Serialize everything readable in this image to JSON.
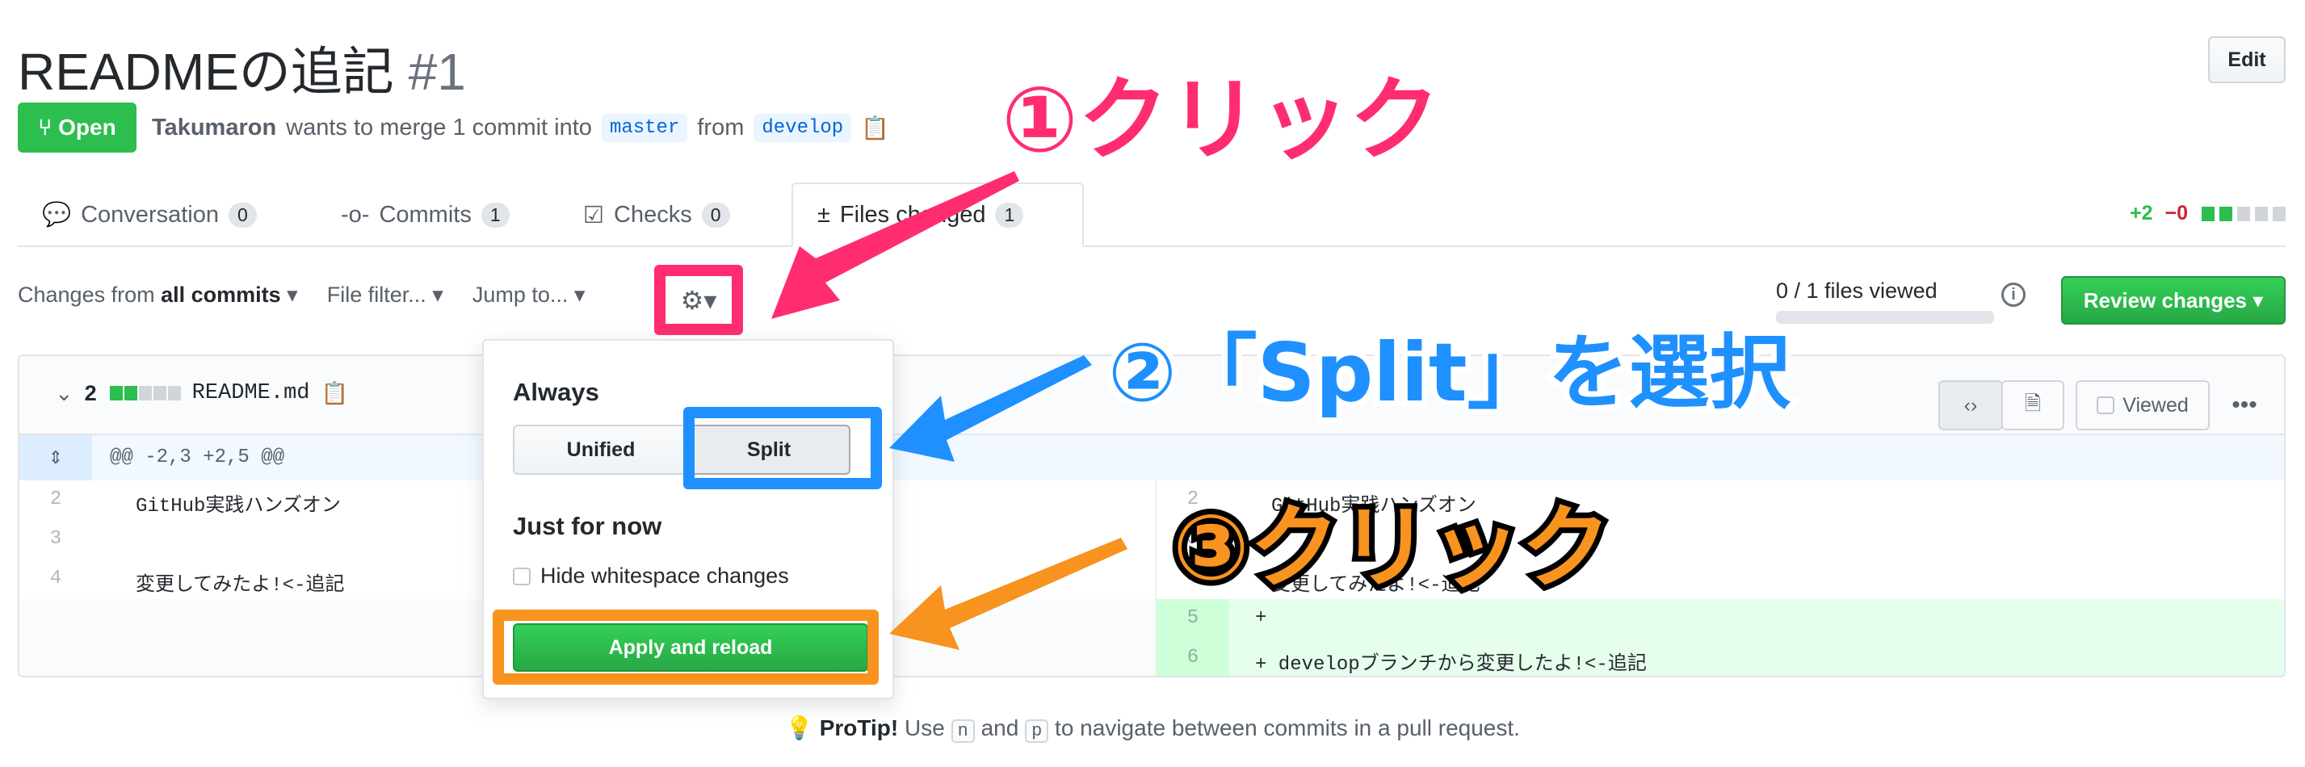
{
  "header": {
    "title": "READMEの追記",
    "number": "#1",
    "edit_label": "Edit",
    "status": "Open",
    "author": "Takumaron",
    "merge_text": "wants to merge 1 commit into",
    "base": "master",
    "from": "from",
    "head": "develop"
  },
  "tabs": [
    {
      "label": "Conversation",
      "count": "0",
      "icon": "comment-discussion-icon"
    },
    {
      "label": "Commits",
      "count": "1",
      "icon": "git-commit-icon"
    },
    {
      "label": "Checks",
      "count": "0",
      "icon": "checklist-icon"
    },
    {
      "label": "Files changed",
      "count": "1",
      "icon": "file-diff-icon",
      "selected": true
    }
  ],
  "diffstat": {
    "added": "+2",
    "removed": "−0",
    "colors": {
      "added": "#2cbe4e",
      "removed": "#cb2431",
      "neutral": "#d1d5da"
    }
  },
  "toolbar": {
    "changes_prefix": "Changes from",
    "changes_value": "all commits",
    "file_filter": "File filter...",
    "jump_to": "Jump to...",
    "files_viewed": "0 / 1 files viewed",
    "review_label": "Review changes"
  },
  "file": {
    "changes": "2",
    "name": "README.md",
    "hunk": "@@ -2,3 +2,5 @@",
    "viewed_label": "Viewed",
    "left": [
      {
        "n": "2",
        "text": "GitHub実践ハンズオン"
      },
      {
        "n": "3",
        "text": ""
      },
      {
        "n": "4",
        "text": "変更してみたよ!<-追記"
      }
    ],
    "right": [
      {
        "n": "2",
        "text": "GitHub実践ハンズオン"
      },
      {
        "n": "3",
        "text": ""
      },
      {
        "n": "4",
        "text": "変更してみたよ!<-追記"
      },
      {
        "n": "5",
        "text": "+"
      },
      {
        "n": "6",
        "text": "+ developブランチから変更したよ!<-追記"
      }
    ]
  },
  "popover": {
    "always": "Always",
    "unified": "Unified",
    "split": "Split",
    "just_for_now": "Just for now",
    "hide_whitespace": "Hide whitespace changes",
    "apply": "Apply and reload"
  },
  "protip": {
    "label": "ProTip!",
    "use": "Use",
    "key1": "n",
    "and": "and",
    "key2": "p",
    "rest": "to navigate between commits in a pull request."
  },
  "annotations": {
    "step1": "①クリック",
    "step2": "②「Split」を選択",
    "step3": "③クリック",
    "colors": {
      "step1": "#ff2d6f",
      "step2": "#1e90ff",
      "step3": "#f7931e"
    }
  }
}
